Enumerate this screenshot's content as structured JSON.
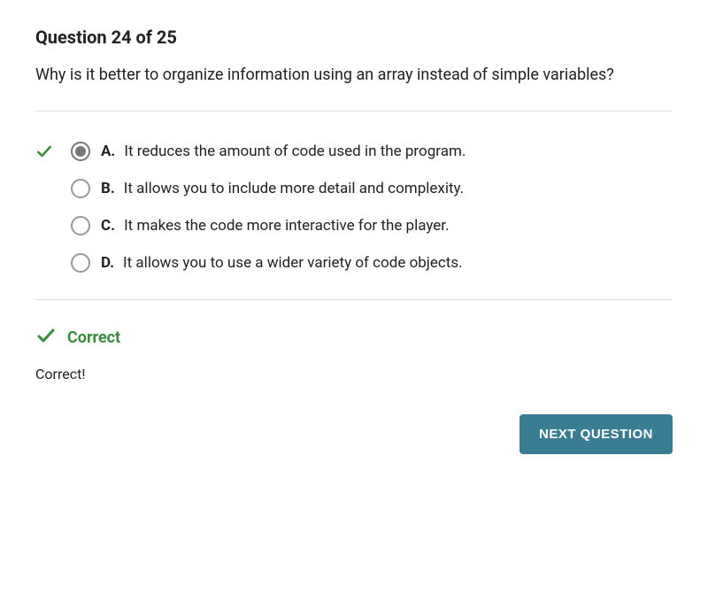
{
  "header": "Question 24 of 25",
  "question": "Why is it better to organize information using an array instead of simple variables?",
  "options": [
    {
      "letter": "A.",
      "text": "It reduces the amount of code used in the program.",
      "selected": true,
      "correct": true
    },
    {
      "letter": "B.",
      "text": "It allows you to include more detail and complexity.",
      "selected": false,
      "correct": false
    },
    {
      "letter": "C.",
      "text": "It makes the code more interactive for the player.",
      "selected": false,
      "correct": false
    },
    {
      "letter": "D.",
      "text": "It allows you to use a wider variety of code objects.",
      "selected": false,
      "correct": false
    }
  ],
  "result": {
    "label": "Correct",
    "feedback": "Correct!"
  },
  "buttons": {
    "next": "NEXT QUESTION"
  }
}
